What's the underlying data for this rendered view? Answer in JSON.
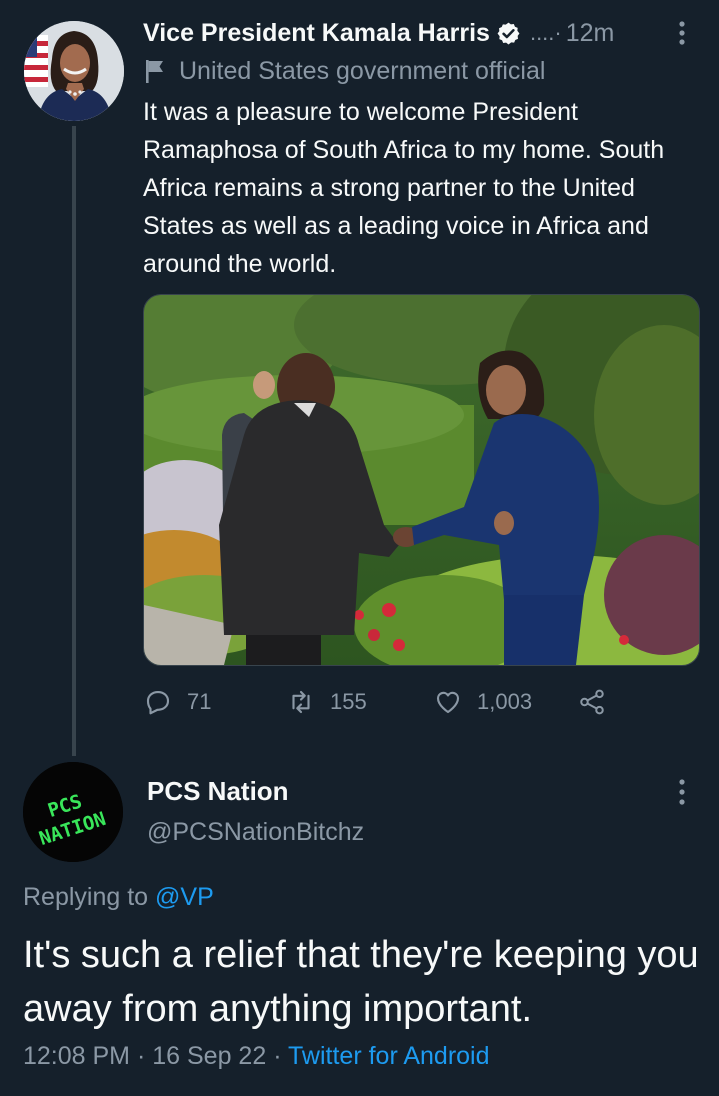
{
  "tweet": {
    "author_name": "Vice President Kamala Harris",
    "handle_ellipsis": "....·",
    "time": "12m",
    "label": "United States government official",
    "text": "It was a pleasure to welcome President Ramaphosa of South Africa to my home. South Africa remains a strong partner to the United States as well as a leading voice in Africa and around the world.",
    "stats": {
      "replies": "71",
      "retweets": "155",
      "likes": "1,003"
    }
  },
  "reply": {
    "author_name": "PCS Nation",
    "handle": "@PCSNationBitchz",
    "avatar_text_line1": "PCS",
    "avatar_text_line2": "NATION",
    "replying_prefix": "Replying to",
    "replying_to": "@VP",
    "text": "It's such a relief that they're keeping you away from anything important.",
    "time": "12:08 PM",
    "date": "16 Sep 22",
    "client": "Twitter for Android"
  },
  "colors": {
    "background": "#15202b",
    "link": "#1d9bf0",
    "secondary_text": "#8b98a5",
    "avatar_text": "#39e65a"
  }
}
